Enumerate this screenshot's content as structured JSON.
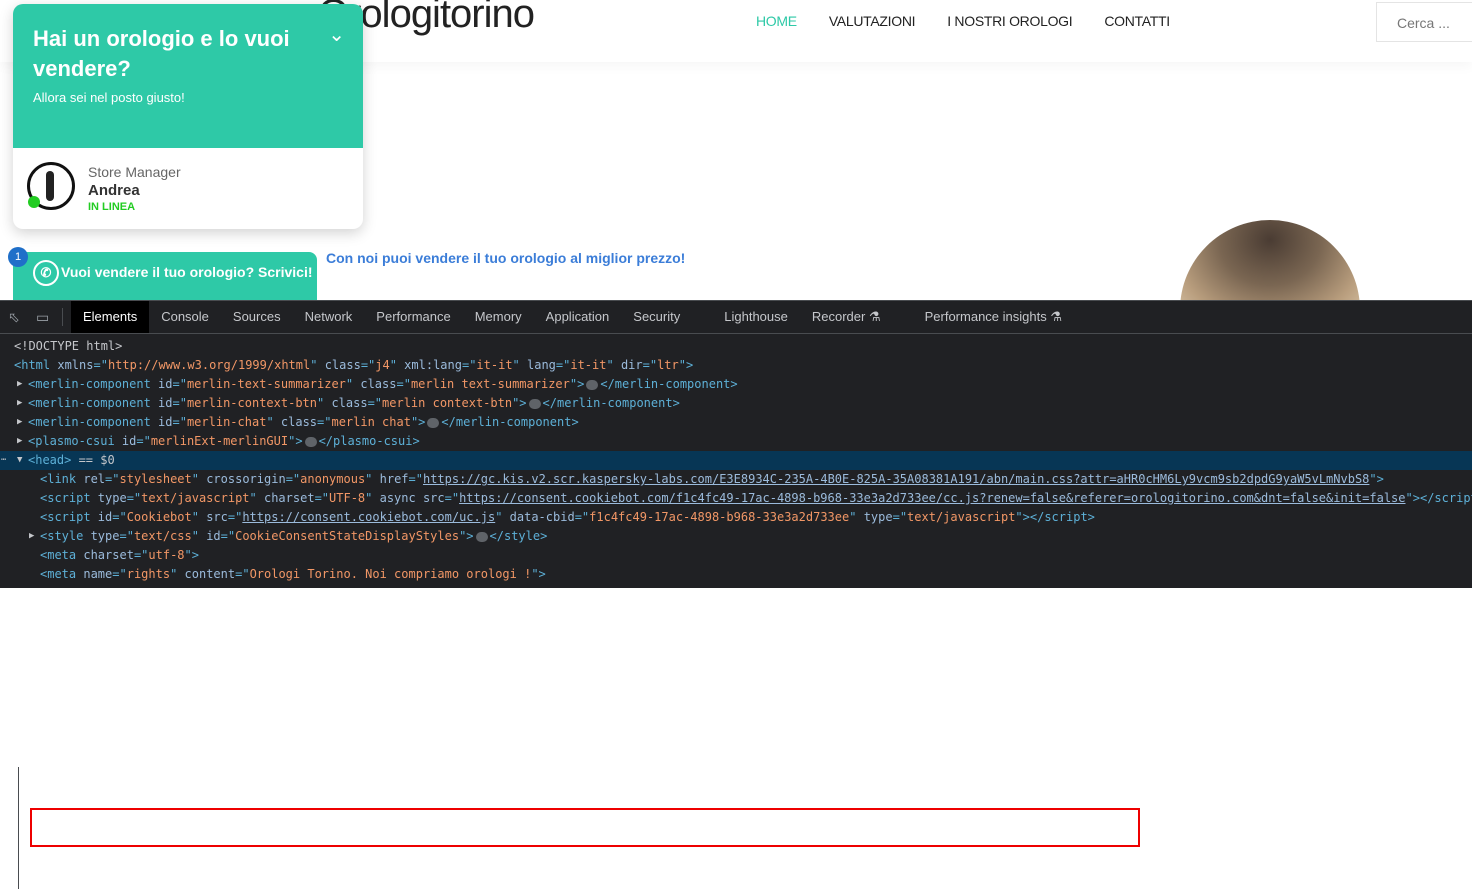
{
  "site": {
    "logo": "Orologitorino",
    "nav": [
      "HOME",
      "VALUTAZIONI",
      "I NOSTRI OROLOGI",
      "CONTATTI"
    ],
    "search_placeholder": "Cerca ...",
    "tagline": "Con noi puoi vendere il tuo orologio al miglior prezzo!"
  },
  "chat": {
    "title": "Hai un orologio e lo vuoi vendere?",
    "subtitle": "Allora sei nel posto giusto!",
    "role": "Store Manager",
    "name": "Andrea",
    "status": "IN LINEA",
    "button": "Vuoi vendere il tuo orologio? Scrivici!",
    "badge": "1",
    "accent": "#2ec9a7"
  },
  "devtools": {
    "tabs": [
      "Elements",
      "Console",
      "Sources",
      "Network",
      "Performance",
      "Memory",
      "Application",
      "Security",
      "Lighthouse",
      "Recorder ⚗",
      "Performance insights ⚗"
    ],
    "lines": [
      {
        "indent": 0,
        "tokens": [
          [
            "x",
            "<!DOCTYPE html>"
          ]
        ]
      },
      {
        "indent": 0,
        "tokens": [
          [
            "t",
            "<html "
          ],
          [
            "a",
            "xmlns"
          ],
          [
            "t",
            "=\""
          ],
          [
            "v",
            "http://www.w3.org/1999/xhtml"
          ],
          [
            "t",
            "\" "
          ],
          [
            "a",
            "class"
          ],
          [
            "t",
            "=\""
          ],
          [
            "v",
            "j4"
          ],
          [
            "t",
            "\" "
          ],
          [
            "a",
            "xml:lang"
          ],
          [
            "t",
            "=\""
          ],
          [
            "v",
            "it-it"
          ],
          [
            "t",
            "\" "
          ],
          [
            "a",
            "lang"
          ],
          [
            "t",
            "=\""
          ],
          [
            "v",
            "it-it"
          ],
          [
            "t",
            "\" "
          ],
          [
            "a",
            "dir"
          ],
          [
            "t",
            "=\""
          ],
          [
            "v",
            "ltr"
          ],
          [
            "t",
            "\">"
          ]
        ]
      },
      {
        "indent": 1,
        "arrow": "▶",
        "tokens": [
          [
            "t",
            "<merlin-component "
          ],
          [
            "a",
            "id"
          ],
          [
            "t",
            "=\""
          ],
          [
            "v",
            "merlin-text-summarizer"
          ],
          [
            "t",
            "\" "
          ],
          [
            "a",
            "class"
          ],
          [
            "t",
            "=\""
          ],
          [
            "v",
            "merlin text-summarizer"
          ],
          [
            "t",
            "\">"
          ],
          [
            "e",
            ""
          ],
          [
            "t",
            "</merlin-component>"
          ]
        ]
      },
      {
        "indent": 1,
        "arrow": "▶",
        "tokens": [
          [
            "t",
            "<merlin-component "
          ],
          [
            "a",
            "id"
          ],
          [
            "t",
            "=\""
          ],
          [
            "v",
            "merlin-context-btn"
          ],
          [
            "t",
            "\" "
          ],
          [
            "a",
            "class"
          ],
          [
            "t",
            "=\""
          ],
          [
            "v",
            "merlin context-btn"
          ],
          [
            "t",
            "\">"
          ],
          [
            "e",
            ""
          ],
          [
            "t",
            "</merlin-component>"
          ]
        ]
      },
      {
        "indent": 1,
        "arrow": "▶",
        "tokens": [
          [
            "t",
            "<merlin-component "
          ],
          [
            "a",
            "id"
          ],
          [
            "t",
            "=\""
          ],
          [
            "v",
            "merlin-chat"
          ],
          [
            "t",
            "\" "
          ],
          [
            "a",
            "class"
          ],
          [
            "t",
            "=\""
          ],
          [
            "v",
            "merlin chat"
          ],
          [
            "t",
            "\">"
          ],
          [
            "e",
            ""
          ],
          [
            "t",
            "</merlin-component>"
          ]
        ]
      },
      {
        "indent": 1,
        "arrow": "▶",
        "tokens": [
          [
            "t",
            "<plasmo-csui "
          ],
          [
            "a",
            "id"
          ],
          [
            "t",
            "=\""
          ],
          [
            "v",
            "merlinExt-merlinGUI"
          ],
          [
            "t",
            "\">"
          ],
          [
            "e",
            ""
          ],
          [
            "t",
            "</plasmo-csui>"
          ]
        ]
      },
      {
        "indent": 1,
        "arrow": "▼",
        "selected": true,
        "tokens": [
          [
            "t",
            "<head>"
          ],
          [
            "x",
            " == "
          ],
          [
            "x",
            "$0"
          ]
        ]
      },
      {
        "indent": 2,
        "tokens": [
          [
            "t",
            "<link "
          ],
          [
            "a",
            "rel"
          ],
          [
            "t",
            "=\""
          ],
          [
            "v",
            "stylesheet"
          ],
          [
            "t",
            "\" "
          ],
          [
            "a",
            "crossorigin"
          ],
          [
            "t",
            "=\""
          ],
          [
            "v",
            "anonymous"
          ],
          [
            "t",
            "\" "
          ],
          [
            "a",
            "href"
          ],
          [
            "t",
            "=\""
          ],
          [
            "l",
            "https://gc.kis.v2.scr.kaspersky-labs.com/E3E8934C-235A-4B0E-825A-35A08381A191/abn/main.css?attr=aHR0cHM6Ly9vcm9sb2dpdG9yaW5vLmNvbS8"
          ],
          [
            "t",
            "\">"
          ]
        ]
      },
      {
        "indent": 2,
        "tokens": [
          [
            "t",
            "<script "
          ],
          [
            "a",
            "type"
          ],
          [
            "t",
            "=\""
          ],
          [
            "v",
            "text/javascript"
          ],
          [
            "t",
            "\" "
          ],
          [
            "a",
            "charset"
          ],
          [
            "t",
            "=\""
          ],
          [
            "v",
            "UTF-8"
          ],
          [
            "t",
            "\" "
          ],
          [
            "a",
            "async src"
          ],
          [
            "t",
            "=\""
          ],
          [
            "l",
            "https://consent.cookiebot.com/f1c4fc49-17ac-4898-b968-33e3a2d733ee/cc.js?renew=false&referer=orologitorino.com&dnt=false&init=false"
          ],
          [
            "t",
            "\"></script>"
          ]
        ]
      },
      {
        "indent": 2,
        "tokens": [
          [
            "t",
            "<script "
          ],
          [
            "a",
            "id"
          ],
          [
            "t",
            "=\""
          ],
          [
            "v",
            "Cookiebot"
          ],
          [
            "t",
            "\" "
          ],
          [
            "a",
            "src"
          ],
          [
            "t",
            "=\""
          ],
          [
            "l",
            "https://consent.cookiebot.com/uc.js"
          ],
          [
            "t",
            "\" "
          ],
          [
            "a",
            "data-cbid"
          ],
          [
            "t",
            "=\""
          ],
          [
            "v",
            "f1c4fc49-17ac-4898-b968-33e3a2d733ee"
          ],
          [
            "t",
            "\" "
          ],
          [
            "a",
            "type"
          ],
          [
            "t",
            "=\""
          ],
          [
            "v",
            "text/javascript"
          ],
          [
            "t",
            "\"></script>"
          ]
        ]
      },
      {
        "indent": 2,
        "arrow": "▶",
        "tokens": [
          [
            "t",
            "<style "
          ],
          [
            "a",
            "type"
          ],
          [
            "t",
            "=\""
          ],
          [
            "v",
            "text/css"
          ],
          [
            "t",
            "\" "
          ],
          [
            "a",
            "id"
          ],
          [
            "t",
            "=\""
          ],
          [
            "v",
            "CookieConsentStateDisplayStyles"
          ],
          [
            "t",
            "\">"
          ],
          [
            "e",
            ""
          ],
          [
            "t",
            "</style>"
          ]
        ]
      },
      {
        "indent": 2,
        "tokens": [
          [
            "t",
            "<meta "
          ],
          [
            "a",
            "charset"
          ],
          [
            "t",
            "=\""
          ],
          [
            "v",
            "utf-8"
          ],
          [
            "t",
            "\">"
          ]
        ]
      },
      {
        "indent": 2,
        "tokens": [
          [
            "t",
            "<meta "
          ],
          [
            "a",
            "name"
          ],
          [
            "t",
            "=\""
          ],
          [
            "v",
            "rights"
          ],
          [
            "t",
            "\" "
          ],
          [
            "a",
            "content"
          ],
          [
            "t",
            "=\""
          ],
          [
            "v",
            "Orologi Torino. Noi compriamo orologi !"
          ],
          [
            "t",
            "\">"
          ]
        ]
      }
    ]
  }
}
